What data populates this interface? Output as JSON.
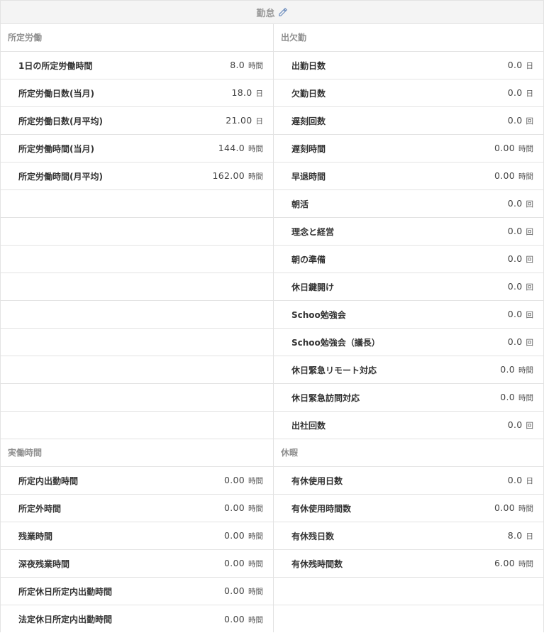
{
  "header": {
    "title": "勤怠"
  },
  "left": {
    "section1": {
      "title": "所定労働",
      "rows": [
        {
          "label": "1日の所定労働時間",
          "value": "8.0",
          "unit": "時間"
        },
        {
          "label": "所定労働日数(当月)",
          "value": "18.0",
          "unit": "日"
        },
        {
          "label": "所定労働日数(月平均)",
          "value": "21.00",
          "unit": "日"
        },
        {
          "label": "所定労働時間(当月)",
          "value": "144.0",
          "unit": "時間"
        },
        {
          "label": "所定労働時間(月平均)",
          "value": "162.00",
          "unit": "時間"
        }
      ]
    },
    "section2": {
      "title": "実働時間",
      "rows": [
        {
          "label": "所定内出勤時間",
          "value": "0.00",
          "unit": "時間"
        },
        {
          "label": "所定外時間",
          "value": "0.00",
          "unit": "時間"
        },
        {
          "label": "残業時間",
          "value": "0.00",
          "unit": "時間"
        },
        {
          "label": "深夜残業時間",
          "value": "0.00",
          "unit": "時間"
        },
        {
          "label": "所定休日所定内出勤時間",
          "value": "0.00",
          "unit": "時間"
        },
        {
          "label": "法定休日所定内出勤時間",
          "value": "0.00",
          "unit": "時間"
        }
      ]
    }
  },
  "right": {
    "section1": {
      "title": "出欠勤",
      "rows": [
        {
          "label": "出勤日数",
          "value": "0.0",
          "unit": "日"
        },
        {
          "label": "欠勤日数",
          "value": "0.0",
          "unit": "日"
        },
        {
          "label": "遅刻回数",
          "value": "0.0",
          "unit": "回"
        },
        {
          "label": "遅刻時間",
          "value": "0.00",
          "unit": "時間"
        },
        {
          "label": "早退時間",
          "value": "0.00",
          "unit": "時間"
        },
        {
          "label": "朝活",
          "value": "0.0",
          "unit": "回"
        },
        {
          "label": "理念と経営",
          "value": "0.0",
          "unit": "回"
        },
        {
          "label": "朝の準備",
          "value": "0.0",
          "unit": "回"
        },
        {
          "label": "休日鍵開け",
          "value": "0.0",
          "unit": "回"
        },
        {
          "label": "Schoo勉強会",
          "value": "0.0",
          "unit": "回"
        },
        {
          "label": "Schoo勉強会（議長）",
          "value": "0.0",
          "unit": "回"
        },
        {
          "label": "休日緊急リモート対応",
          "value": "0.0",
          "unit": "時間"
        },
        {
          "label": "休日緊急訪問対応",
          "value": "0.0",
          "unit": "時間"
        },
        {
          "label": "出社回数",
          "value": "0.0",
          "unit": "回"
        }
      ]
    },
    "section2": {
      "title": "休暇",
      "rows": [
        {
          "label": "有休使用日数",
          "value": "0.0",
          "unit": "日"
        },
        {
          "label": "有休使用時間数",
          "value": "0.00",
          "unit": "時間"
        },
        {
          "label": "有休残日数",
          "value": "8.0",
          "unit": "日"
        },
        {
          "label": "有休残時間数",
          "value": "6.00",
          "unit": "時間"
        }
      ]
    }
  }
}
